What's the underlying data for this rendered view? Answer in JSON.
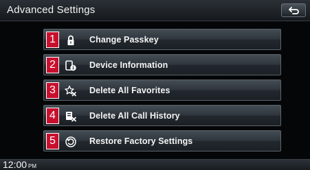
{
  "header": {
    "title": "Advanced Settings",
    "back_icon": "back-arrow-icon"
  },
  "menu": {
    "items": [
      {
        "number": "1",
        "icon": "lock-icon",
        "label": "Change Passkey"
      },
      {
        "number": "2",
        "icon": "device-info-icon",
        "label": "Device Information"
      },
      {
        "number": "3",
        "icon": "delete-favorites-icon",
        "label": "Delete All Favorites"
      },
      {
        "number": "4",
        "icon": "delete-call-history-icon",
        "label": "Delete All Call History"
      },
      {
        "number": "5",
        "icon": "restore-settings-icon",
        "label": "Restore Factory Settings"
      }
    ]
  },
  "status_bar": {
    "time": "12:00",
    "ampm": "PM"
  },
  "colors": {
    "number_badge": "#c8102e",
    "background": "#050607",
    "button_border": "#5b646d"
  }
}
